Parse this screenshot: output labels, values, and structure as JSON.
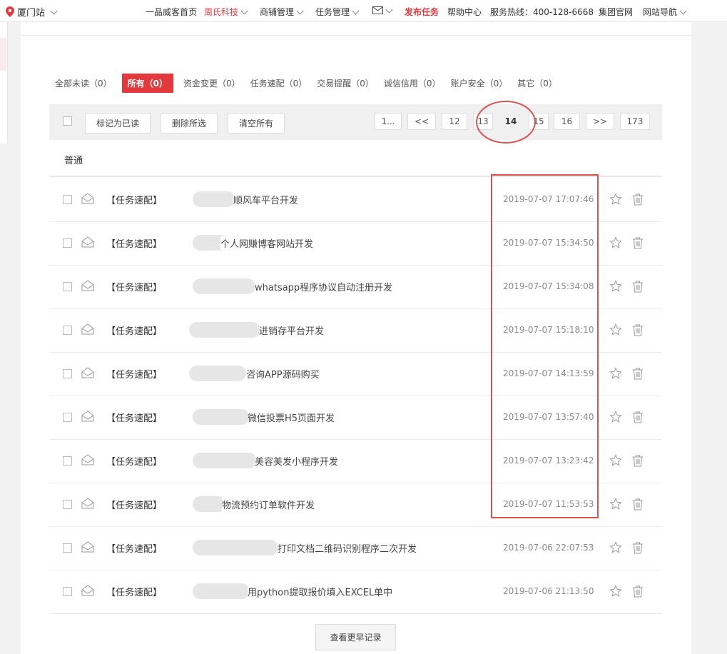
{
  "topbar": {
    "city": "厦门站",
    "nav": [
      {
        "label": "一品威客首页",
        "style": "normal",
        "dropdown": false
      },
      {
        "label": "周氏科技",
        "style": "red",
        "dropdown": true
      },
      {
        "label": "商铺管理",
        "style": "normal",
        "dropdown": true
      },
      {
        "label": "任务管理",
        "style": "normal",
        "dropdown": true
      },
      {
        "label": "发布任务",
        "style": "red-bold",
        "dropdown": false
      },
      {
        "label": "帮助中心",
        "style": "normal",
        "dropdown": false
      },
      {
        "label": "服务热线：400-128-6668",
        "style": "normal",
        "dropdown": false
      },
      {
        "label": "集团官网",
        "style": "normal",
        "dropdown": false
      },
      {
        "label": "网站导航",
        "style": "normal",
        "dropdown": true
      }
    ],
    "mail_icon": "mail-icon"
  },
  "filters": [
    {
      "label": "全部未读（0）",
      "active": false
    },
    {
      "label": "所有（0）",
      "active": true
    },
    {
      "label": "资金变更（0）",
      "active": false
    },
    {
      "label": "任务速配（0）",
      "active": false
    },
    {
      "label": "交易提醒（0）",
      "active": false
    },
    {
      "label": "诚信信用（0）",
      "active": false
    },
    {
      "label": "账户安全（0）",
      "active": false
    },
    {
      "label": "其它（0）",
      "active": false
    }
  ],
  "toolbar": {
    "mark_read": "标记为已读",
    "delete_selected": "删除所选",
    "clear_all": "清空所有"
  },
  "pagination": {
    "items": [
      "1...",
      "<<",
      "12",
      "13",
      "14",
      "15",
      "16",
      ">>",
      "173"
    ],
    "current": "14"
  },
  "section_title": "普通",
  "messages": [
    {
      "tag": "【任务速配】",
      "title": "顺风车平台开发",
      "time": "2019-07-07 17:07:46"
    },
    {
      "tag": "【任务速配】",
      "title": "个人网赚博客网站开发",
      "time": "2019-07-07 15:34:50"
    },
    {
      "tag": "【任务速配】",
      "title": "whatsapp程序协议自动注册开发",
      "time": "2019-07-07 15:34:08"
    },
    {
      "tag": "【任务速配】",
      "title": "进销存平台开发",
      "time": "2019-07-07 15:18:10"
    },
    {
      "tag": "【任务速配】",
      "title": "咨询APP源码购买",
      "time": "2019-07-07 14:13:59"
    },
    {
      "tag": "【任务速配】",
      "title": "微信投票H5页面开发",
      "time": "2019-07-07 13:57:40"
    },
    {
      "tag": "【任务速配】",
      "title": "美容美发小程序开发",
      "time": "2019-07-07 13:23:42"
    },
    {
      "tag": "【任务速配】",
      "title": "物流预约订单软件开发",
      "time": "2019-07-07 11:53:53"
    },
    {
      "tag": "【任务速配】",
      "title": "打印文档二维码识别程序二次开发",
      "time": "2019-07-06 22:07:53"
    },
    {
      "tag": "【任务速配】",
      "title": "用python提取报价填入EXCEL单中",
      "time": "2019-07-06 21:13:50"
    }
  ],
  "more_button": "查看更早记录",
  "colors": {
    "accent": "#e4393c",
    "annotation": "#d9534f"
  }
}
